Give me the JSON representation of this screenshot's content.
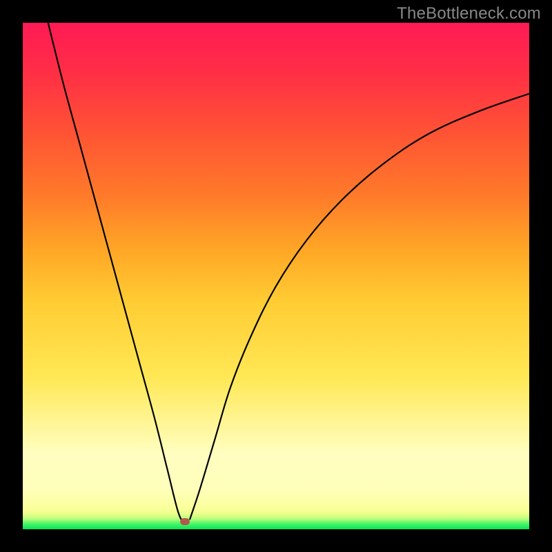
{
  "watermark": {
    "text": "TheBottleneck.com"
  },
  "colors": {
    "frame": "#000000",
    "marker": "#b05a4c",
    "curve_stroke": "#000000",
    "gradient_stops": [
      "#00e756",
      "#ffffbb",
      "#ffe855",
      "#ffa726",
      "#ff5733",
      "#ff1a54"
    ]
  },
  "chart_data": {
    "type": "line",
    "title": "",
    "xlabel": "",
    "ylabel": "",
    "xlim": [
      0,
      100
    ],
    "ylim": [
      0,
      100
    ],
    "grid": false,
    "marker": {
      "x": 32,
      "y": 1.5,
      "shape": "rounded-rect"
    },
    "left_curve": {
      "_comment": "Steep descending branch from top-left to the trough.",
      "x": [
        5,
        8,
        11,
        14,
        17,
        20,
        23,
        26,
        28.5,
        30.5,
        31.5
      ],
      "y": [
        100,
        88,
        77,
        66,
        55,
        44,
        33,
        22,
        12,
        4,
        1.5
      ]
    },
    "right_curve": {
      "_comment": "Ascending saturating branch from just past the trough toward the right edge.",
      "x": [
        33,
        35,
        38,
        41,
        45,
        50,
        56,
        63,
        71,
        80,
        90,
        100
      ],
      "y": [
        2,
        8,
        18,
        28,
        38,
        48,
        57,
        65,
        72,
        78,
        82.5,
        86
      ]
    }
  }
}
